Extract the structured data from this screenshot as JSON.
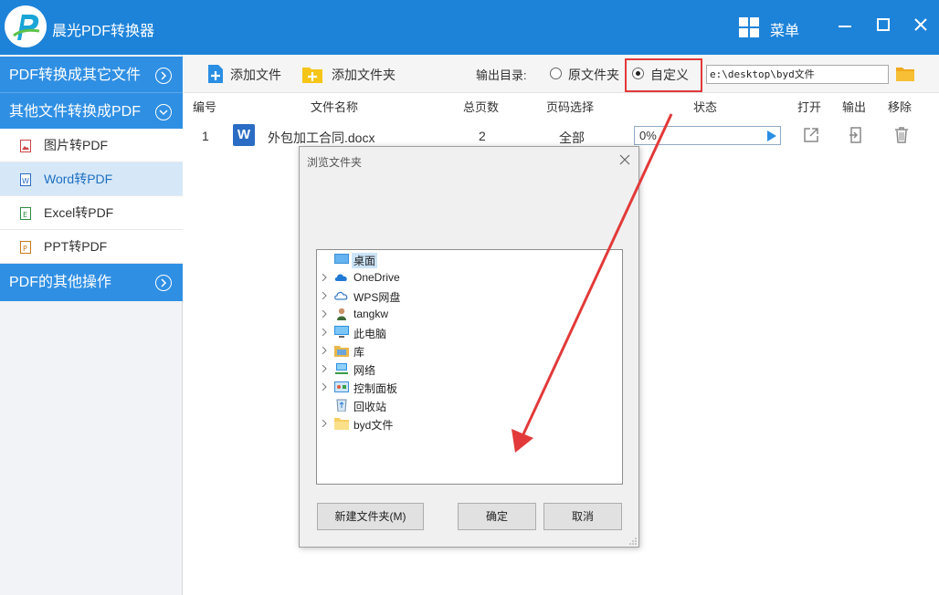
{
  "app": {
    "title": "晨光PDF转换器",
    "menu_label": "菜单"
  },
  "sidebar": {
    "section1": "PDF转换成其它文件",
    "section2": "其他文件转换成PDF",
    "items": [
      {
        "label": "图片转PDF"
      },
      {
        "label": "Word转PDF"
      },
      {
        "label": "Excel转PDF"
      },
      {
        "label": "PPT转PDF"
      }
    ],
    "section3": "PDF的其他操作"
  },
  "toolbar": {
    "add_file": "添加文件",
    "add_folder": "添加文件夹",
    "output_dir_label": "输出目录:",
    "option_original": "原文件夹",
    "option_custom": "自定义",
    "output_path": "e:\\desktop\\byd文件"
  },
  "table": {
    "headers": [
      "编号",
      "文件名称",
      "总页数",
      "页码选择",
      "状态",
      "打开",
      "输出",
      "移除"
    ],
    "rows": [
      {
        "index": "1",
        "name": "外包加工合同.docx",
        "pages": "2",
        "range": "全部",
        "progress_text": "0%",
        "progress": 0
      }
    ]
  },
  "dialog": {
    "title": "浏览文件夹",
    "tree": [
      {
        "label": "桌面",
        "icon": "desktop-icon"
      },
      {
        "label": "OneDrive",
        "icon": "cloud-icon"
      },
      {
        "label": "WPS网盘",
        "icon": "cloud-outline-icon"
      },
      {
        "label": "tangkw",
        "icon": "user-icon"
      },
      {
        "label": "此电脑",
        "icon": "computer-icon"
      },
      {
        "label": "库",
        "icon": "library-icon"
      },
      {
        "label": "网络",
        "icon": "network-icon"
      },
      {
        "label": "控制面板",
        "icon": "control-panel-icon"
      },
      {
        "label": "回收站",
        "icon": "recycle-bin-icon"
      },
      {
        "label": "byd文件",
        "icon": "folder-icon"
      }
    ],
    "new_folder": "新建文件夹(M)",
    "ok": "确定",
    "cancel": "取消"
  },
  "colors": {
    "brand": "#1d83d9",
    "sidebar_head": "#2f8fe3",
    "highlight": "#e23a3a"
  }
}
